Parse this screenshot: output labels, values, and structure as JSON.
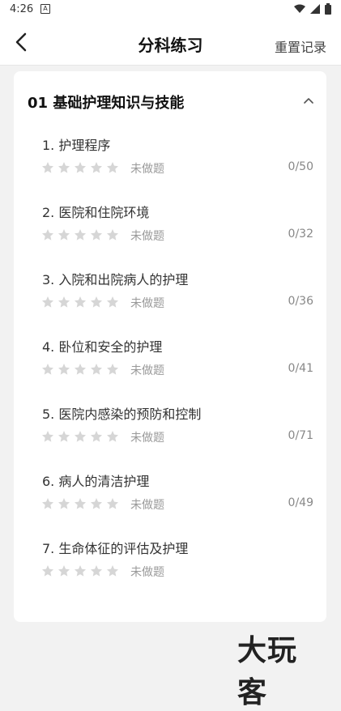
{
  "status_bar": {
    "time": "4:26",
    "a_glyph": "A"
  },
  "nav": {
    "title": "分科练习",
    "reset": "重置记录"
  },
  "section": {
    "title": "01 基础护理知识与技能"
  },
  "items": [
    {
      "title": "1. 护理程序",
      "status": "未做题",
      "progress": "0/50"
    },
    {
      "title": "2. 医院和住院环境",
      "status": "未做题",
      "progress": "0/32"
    },
    {
      "title": "3. 入院和出院病人的护理",
      "status": "未做题",
      "progress": "0/36"
    },
    {
      "title": "4. 卧位和安全的护理",
      "status": "未做题",
      "progress": "0/41"
    },
    {
      "title": "5. 医院内感染的预防和控制",
      "status": "未做题",
      "progress": "0/71"
    },
    {
      "title": "6. 病人的清洁护理",
      "status": "未做题",
      "progress": "0/49"
    },
    {
      "title": "7. 生命体征的评估及护理",
      "status": "未做题",
      "progress": ""
    }
  ],
  "watermark": "大玩客",
  "colors": {
    "star_empty": "#d6d6d6",
    "muted_text": "#999999"
  }
}
